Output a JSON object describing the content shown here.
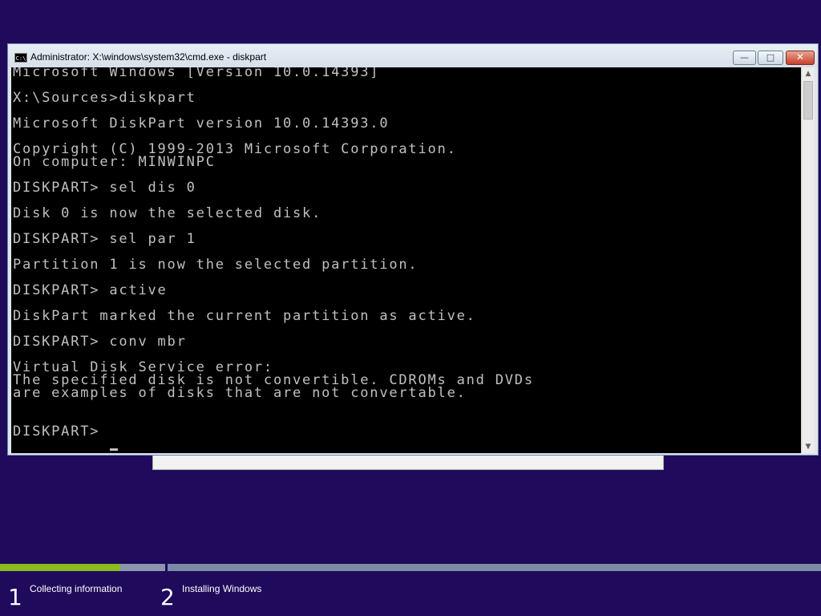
{
  "window": {
    "title": "Administrator: X:\\windows\\system32\\cmd.exe - diskpart",
    "icon_label": "C:\\",
    "minimize_glyph": "—",
    "maximize_glyph": "□",
    "close_glyph": "✕"
  },
  "console": {
    "text": "Microsoft Windows [Version 10.0.14393]\n\nX:\\Sources>diskpart\n\nMicrosoft DiskPart version 10.0.14393.0\n\nCopyright (C) 1999-2013 Microsoft Corporation.\nOn computer: MINWINPC\n\nDISKPART> sel dis 0\n\nDisk 0 is now the selected disk.\n\nDISKPART> sel par 1\n\nPartition 1 is now the selected partition.\n\nDISKPART> active\n\nDiskPart marked the current partition as active.\n\nDISKPART> conv mbr\n\nVirtual Disk Service error:\nThe specified disk is not convertible. CDROMs and DVDs\nare examples of disks that are not convertable.\n\n\nDISKPART> "
  },
  "scrollbar": {
    "up_glyph": "▲",
    "down_glyph": "▼"
  },
  "setup": {
    "progress_fraction": 0.73,
    "steps": [
      {
        "number": "1",
        "label": "Collecting information"
      },
      {
        "number": "2",
        "label": "Installing Windows"
      }
    ]
  },
  "colors": {
    "background": "#1f0a5c",
    "console_bg": "#000000",
    "console_fg": "#c0c0c0",
    "progress_fill": "#8cbc1e"
  }
}
